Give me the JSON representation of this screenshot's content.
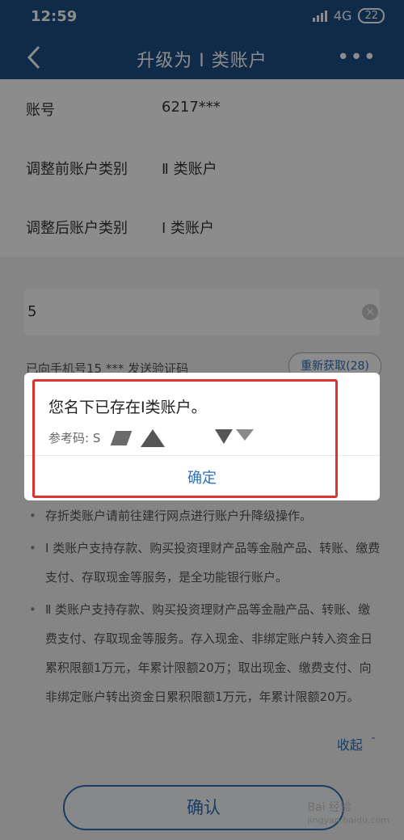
{
  "status_bar": {
    "time": "12:59",
    "network": "4G",
    "battery": "22"
  },
  "nav": {
    "title": "升级为 Ⅰ 类账户",
    "more": "•••"
  },
  "info": [
    {
      "label": "账号",
      "value": "6217***"
    },
    {
      "label": "调整前账户类别",
      "value": "Ⅱ 类账户"
    },
    {
      "label": "调整后账户类别",
      "value": "Ⅰ 类账户"
    }
  ],
  "verify": {
    "code_value": "5",
    "sms_text": "已向手机号15 ***  发送验证码",
    "resend_label": "重新获取(28)"
  },
  "dialog": {
    "message": "您名下已存在Ⅰ类账户。",
    "ref_label": "参考码: S",
    "confirm_label": "确定"
  },
  "notes": [
    "存折类账户请前往建行网点进行账户升降级操作。",
    "Ⅰ 类账户支持存款、购买投资理财产品等金融产品、转账、缴费支付、存取现金等服务，是全功能银行账户。",
    "Ⅱ 类账户支持存款、购买投资理财产品等金融产品、转账、缴费支付、存取现金等服务。存入现金、非绑定账户转入资金日累积限额1万元，年累计限额20万；取出现金、缴费支付、向非绑定账户转出资金日累积限额1万元，年累计限额20万。"
  ],
  "collapse_label": "收起 ＾",
  "confirm_main_label": "确认",
  "watermark": {
    "brand": "Bai 经验",
    "site": "jingyan.baidu.com"
  },
  "colors": {
    "header": "#1e4f86",
    "accent": "#2f6fb6",
    "highlight": "#dd3333"
  }
}
